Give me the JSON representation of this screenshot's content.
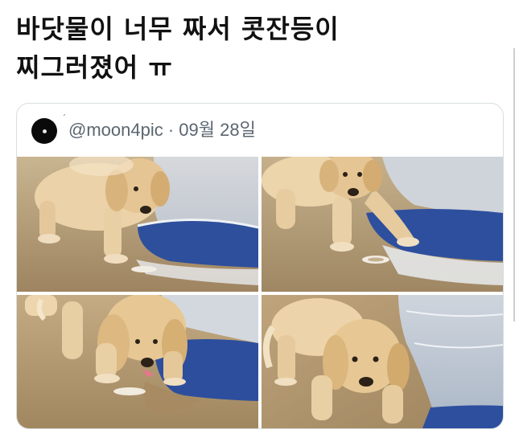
{
  "post": {
    "text_line1": "바닷물이 너무 짜서 콧잔등이",
    "text_line2": "찌그러졌어 ㅠ"
  },
  "quoted_tweet": {
    "handle_line": "@moon4pic · 09월 28일",
    "avatar_icon": "moon-avatar-icon",
    "photos": [
      {
        "name": "puppy-photo-1"
      },
      {
        "name": "puppy-photo-2"
      },
      {
        "name": "puppy-photo-3"
      },
      {
        "name": "puppy-photo-4"
      }
    ]
  },
  "colors": {
    "sand": "#b9a27e",
    "water": "#2f55a6",
    "puppy_fur": "#e9cfa3",
    "card_border": "#d9dee2",
    "handle_text": "#5b6670"
  }
}
